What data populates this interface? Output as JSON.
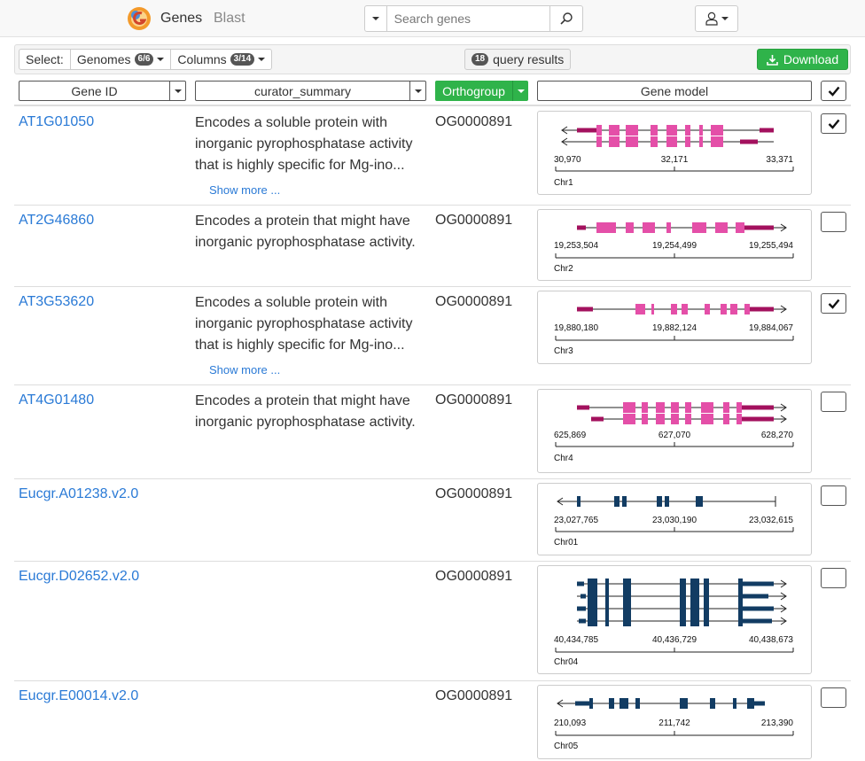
{
  "navbar": {
    "brand": "Genes",
    "blast": "Blast",
    "search_placeholder": "Search genes"
  },
  "toolbar": {
    "select_label": "Select:",
    "genomes_label": "Genomes",
    "genomes_badge": "6/6",
    "columns_label": "Columns",
    "columns_badge": "3/14",
    "results_count": "18",
    "results_label": "query results",
    "download_label": "Download"
  },
  "header": {
    "gene_id": "Gene ID",
    "curator_summary": "curator_summary",
    "orthogroup": "Orthogroup",
    "gene_model": "Gene model",
    "all_checked": true
  },
  "colors": {
    "link": "#2a7ad6",
    "green": "#2fb34a",
    "exon_pink": "#e44fa8",
    "utr_pink": "#a3115e",
    "exon_navy": "#123c63"
  },
  "rows": [
    {
      "gene_id": "AT1G01050",
      "summary": "Encodes a soluble protein with inorganic pyrophosphatase activity that is highly specific for Mg-ino...",
      "show_more": "Show more ...",
      "orthogroup": "OG0000891",
      "checked": true,
      "chrom": "Chr1",
      "ticks": [
        "30,970",
        "32,171",
        "33,371"
      ]
    },
    {
      "gene_id": "AT2G46860",
      "summary": "Encodes a protein that might have inorganic pyrophosphatase activity.",
      "show_more": "",
      "orthogroup": "OG0000891",
      "checked": false,
      "chrom": "Chr2",
      "ticks": [
        "19,253,504",
        "19,254,499",
        "19,255,494"
      ]
    },
    {
      "gene_id": "AT3G53620",
      "summary": "Encodes a soluble protein with inorganic pyrophosphatase activity that is highly specific for Mg-ino...",
      "show_more": "Show more ...",
      "orthogroup": "OG0000891",
      "checked": true,
      "chrom": "Chr3",
      "ticks": [
        "19,880,180",
        "19,882,124",
        "19,884,067"
      ]
    },
    {
      "gene_id": "AT4G01480",
      "summary": "Encodes a protein that might have inorganic pyrophosphatase activity.",
      "show_more": "",
      "orthogroup": "OG0000891",
      "checked": false,
      "chrom": "Chr4",
      "ticks": [
        "625,869",
        "627,070",
        "628,270"
      ]
    },
    {
      "gene_id": "Eucgr.A01238.v2.0",
      "summary": "",
      "show_more": "",
      "orthogroup": "OG0000891",
      "checked": false,
      "chrom": "Chr01",
      "ticks": [
        "23,027,765",
        "23,030,190",
        "23,032,615"
      ]
    },
    {
      "gene_id": "Eucgr.D02652.v2.0",
      "summary": "",
      "show_more": "",
      "orthogroup": "OG0000891",
      "checked": false,
      "chrom": "Chr04",
      "ticks": [
        "40,434,785",
        "40,436,729",
        "40,438,673"
      ]
    },
    {
      "gene_id": "Eucgr.E00014.v2.0",
      "summary": "",
      "show_more": "",
      "orthogroup": "OG0000891",
      "checked": false,
      "chrom": "Chr05",
      "ticks": [
        "210,093",
        "211,742",
        "213,390"
      ]
    }
  ]
}
